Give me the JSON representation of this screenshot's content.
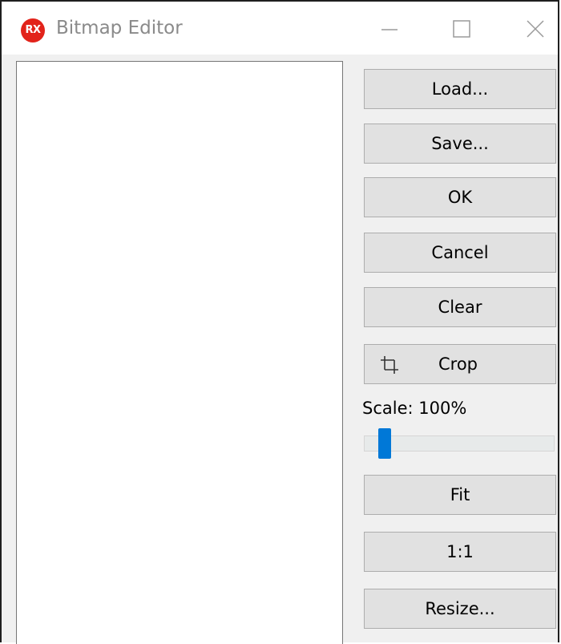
{
  "window": {
    "title": "Bitmap Editor",
    "app_icon_text": "RX"
  },
  "buttons": {
    "load": "Load...",
    "save": "Save...",
    "ok": "OK",
    "cancel": "Cancel",
    "clear": "Clear",
    "crop": "Crop",
    "fit": "Fit",
    "one_to_one": "1:1",
    "resize": "Resize..."
  },
  "scale": {
    "label": "Scale: 100%",
    "slider_value_fraction": 0.08
  },
  "icons": {
    "app": "rx-logo-icon",
    "minimize": "minimize-icon",
    "maximize": "maximize-icon",
    "close": "close-icon",
    "crop": "crop-icon"
  },
  "colors": {
    "app_icon": "#e2231a",
    "slider_thumb": "#0078d7",
    "button_face": "#e1e1e1",
    "window_background": "#f0f0f0"
  }
}
